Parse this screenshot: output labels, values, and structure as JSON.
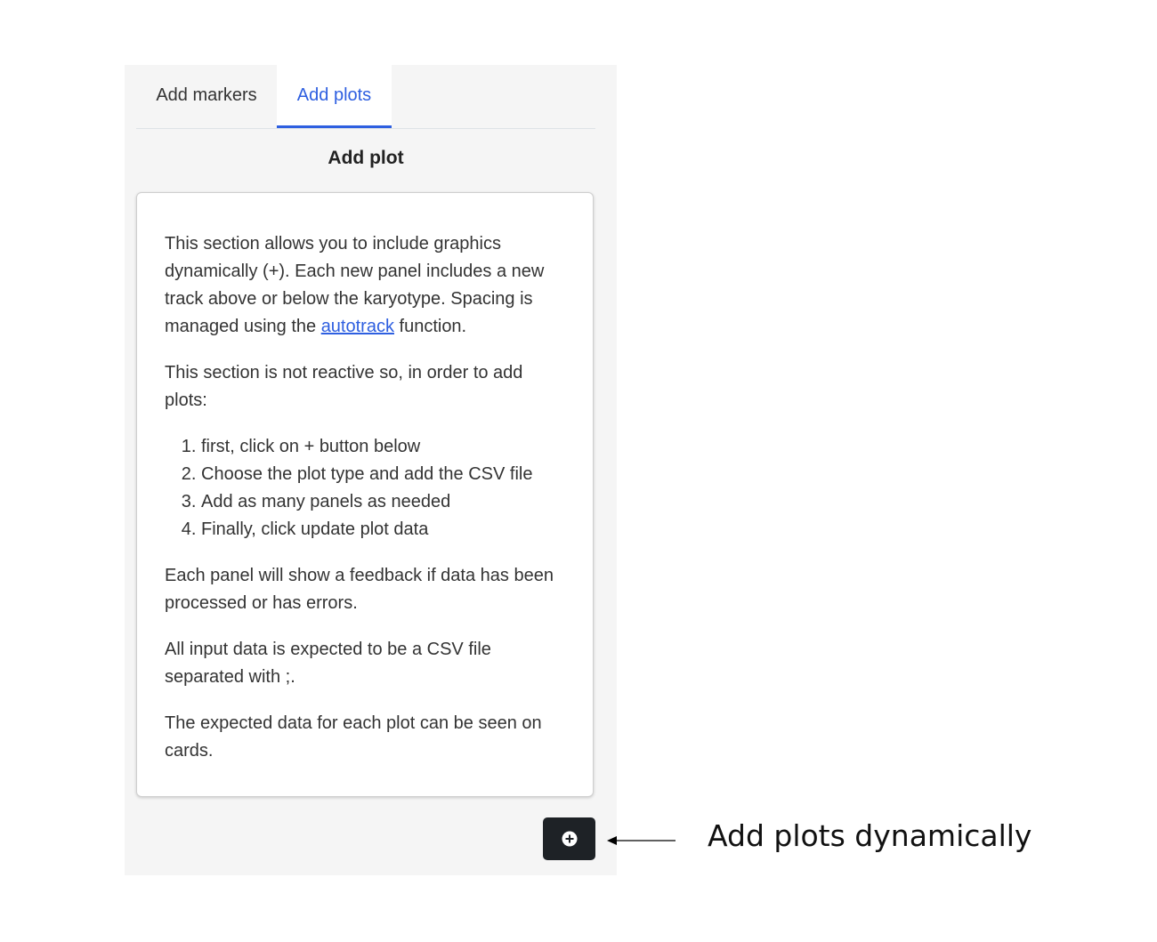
{
  "tabs": [
    {
      "label": "Add markers",
      "active": false
    },
    {
      "label": "Add plots",
      "active": true
    }
  ],
  "section_title": "Add plot",
  "card": {
    "intro_before_link": "This section allows you to include graphics dynamically (+). Each new panel includes a new track above or below the karyotype. Spacing is managed using the ",
    "link_text": "autotrack",
    "intro_after_link": " function.",
    "not_reactive": "This section is not reactive so, in order to add plots:",
    "steps": [
      "first, click on + button below",
      "Choose the plot type and add the CSV file",
      "Add as many panels as needed",
      "Finally, click update plot data"
    ],
    "feedback": "Each panel will show a feedback if data has been processed or has errors.",
    "csv_note": "All input data is expected to be a CSV file separated with ;.",
    "cards_note": "The expected data for each plot can be seen on cards."
  },
  "add_button": {
    "icon": "plus-circle-icon"
  },
  "annotation": {
    "text": "Add plots dynamically"
  },
  "colors": {
    "accent": "#2e5fe0",
    "button_bg": "#1e2226",
    "sidebar_bg": "#f5f5f5"
  }
}
